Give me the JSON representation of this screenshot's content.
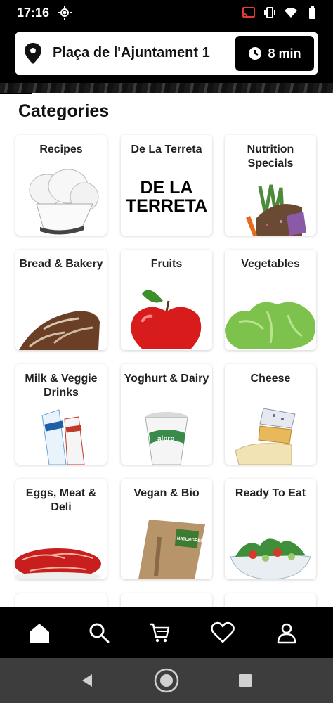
{
  "status": {
    "time": "17:16"
  },
  "header": {
    "address": "Plaça de l'Ajuntament 1",
    "eta": "8 min"
  },
  "page": {
    "title": "Categories"
  },
  "categories": [
    {
      "label": "Recipes",
      "icon": "chef-hat-image"
    },
    {
      "label": "De La Terreta",
      "icon": "de-la-terreta-logo",
      "logo_text": "DE LA TERRETA"
    },
    {
      "label": "Nutrition Specials",
      "icon": "superfood-image"
    },
    {
      "label": "Bread & Bakery",
      "icon": "bread-image"
    },
    {
      "label": "Fruits",
      "icon": "apple-image"
    },
    {
      "label": "Vegetables",
      "icon": "lettuce-image"
    },
    {
      "label": "Milk & Veggie Drinks",
      "icon": "milk-cartons-image"
    },
    {
      "label": "Yoghurt & Dairy",
      "icon": "yoghurt-image"
    },
    {
      "label": "Cheese",
      "icon": "cheese-image"
    },
    {
      "label": "Eggs, Meat & Deli",
      "icon": "ham-image"
    },
    {
      "label": "Vegan & Bio",
      "icon": "vegan-bag-image",
      "pack_text": "NATURGREEN"
    },
    {
      "label": "Ready To Eat",
      "icon": "salad-bowl-image"
    }
  ],
  "nav": [
    "home-icon",
    "search-icon",
    "cart-icon",
    "heart-icon",
    "profile-icon"
  ]
}
